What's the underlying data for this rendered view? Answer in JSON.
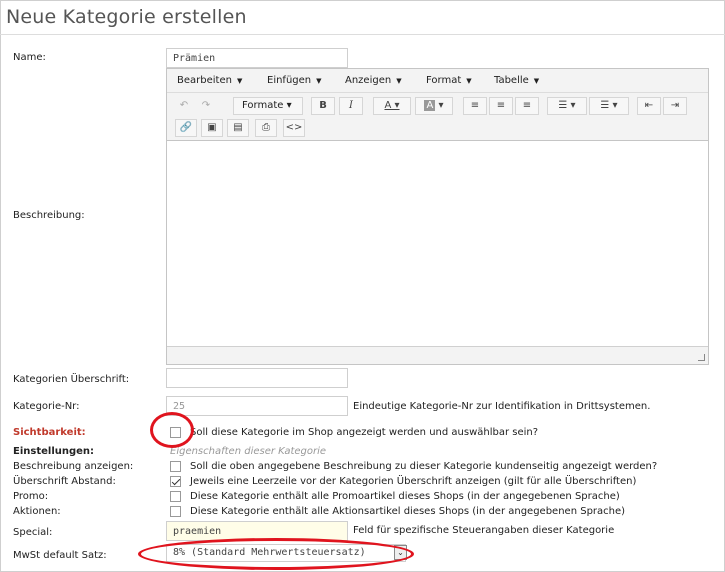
{
  "page": {
    "title": "Neue Kategorie erstellen"
  },
  "colors": {
    "annotation": "#e0141e",
    "label_warning": "#c0392b"
  },
  "fields": {
    "name": {
      "label": "Name:",
      "value": "Prämien"
    },
    "beschreibung": {
      "label": "Beschreibung:"
    },
    "kategorien_ueberschrift": {
      "label": "Kategorien Überschrift:",
      "value": ""
    },
    "kategorie_nr": {
      "label": "Kategorie-Nr:",
      "value": "25",
      "hint": "Eindeutige Kategorie-Nr zur Identifikation in Drittsystemen."
    },
    "sichtbarkeit": {
      "label": "Sichtbarkeit:",
      "hint": "Soll diese Kategorie im Shop angezeigt werden und auswählbar sein?",
      "checked": false
    },
    "einstellungen": {
      "label": "Einstellungen:",
      "hint": "Eigenschaften dieser Kategorie"
    },
    "beschreibung_anzeigen": {
      "label": "Beschreibung anzeigen:",
      "hint": "Soll die oben angegebene Beschreibung zu dieser Kategorie kundenseitig angezeigt werden?",
      "checked": false
    },
    "ueberschrift_abstand": {
      "label": "Überschrift Abstand:",
      "hint": "Jeweils eine Leerzeile vor der Kategorien Überschrift anzeigen (gilt für alle Überschriften)",
      "checked": true
    },
    "promo": {
      "label": "Promo:",
      "hint": "Diese Kategorie enthält alle Promoartikel dieses Shops (in der angegebenen Sprache)",
      "checked": false
    },
    "aktionen": {
      "label": "Aktionen:",
      "hint": "Diese Kategorie enthält alle Aktionsartikel dieses Shops (in der angegebenen Sprache)",
      "checked": false
    },
    "special": {
      "label": "Special:",
      "value": "praemien",
      "hint": "Feld für spezifische Steuerangaben dieser Kategorie"
    },
    "mwst": {
      "label": "MwSt default Satz:",
      "value": "8% (Standard Mehrwertsteuersatz)"
    }
  },
  "editor": {
    "menus": [
      "Bearbeiten",
      "Einfügen",
      "Anzeigen",
      "Format",
      "Tabelle"
    ],
    "formats_label": "Formate",
    "bold": "B",
    "italic": "I",
    "code": "<>",
    "icons": [
      "undo-icon",
      "redo-icon",
      "bold-icon",
      "italic-icon",
      "text-color-icon",
      "background-color-icon",
      "align-left-icon",
      "align-center-icon",
      "align-right-icon",
      "bullet-list-icon",
      "numbered-list-icon",
      "outdent-icon",
      "indent-icon",
      "link-icon",
      "image-icon",
      "media-icon",
      "print-icon",
      "source-code-icon"
    ]
  }
}
